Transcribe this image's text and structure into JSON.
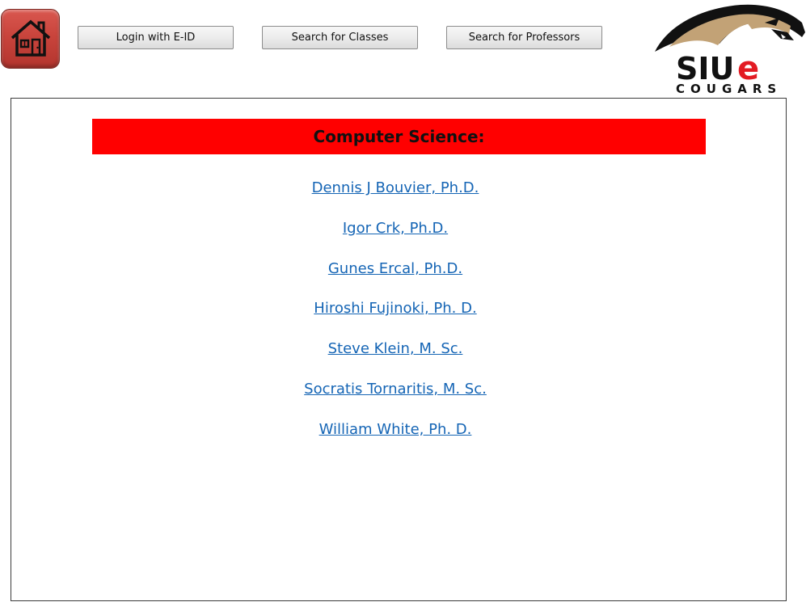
{
  "header": {
    "home_icon": "house-icon",
    "buttons": {
      "login_label": "Login with E-ID",
      "search_classes_label": "Search for Classes",
      "search_professors_label": "Search for Professors"
    },
    "logo": {
      "text_main": "SIUe",
      "text_sub": "COUGARS",
      "colors": {
        "cougar_tan": "#c2a276",
        "cougar_dark": "#111111",
        "e_red": "#e31b23"
      }
    }
  },
  "main": {
    "department_title": "Computer Science:",
    "header_color": "#ff0000",
    "link_color": "#1565b5",
    "professors": [
      "Dennis J Bouvier, Ph.D.",
      "Igor Crk, Ph.D.",
      "Gunes Ercal, Ph.D.",
      "Hiroshi Fujinoki, Ph. D.",
      "Steve Klein, M. Sc.",
      "Socratis Tornaritis, M. Sc.",
      "William White, Ph. D."
    ]
  }
}
